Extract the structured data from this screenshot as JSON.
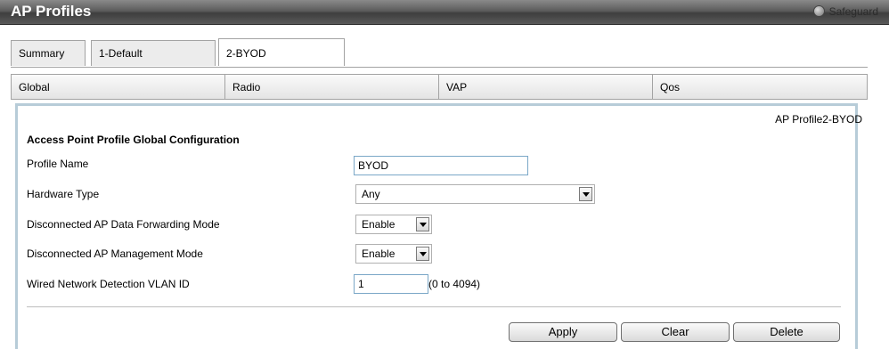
{
  "header": {
    "title": "AP Profiles",
    "safeguard_label": "Safeguard"
  },
  "profile_tabs": [
    {
      "label": "Summary"
    },
    {
      "label": "1-Default"
    },
    {
      "label": "2-BYOD",
      "active": true
    }
  ],
  "section_tabs": [
    {
      "label": "Global",
      "active": true
    },
    {
      "label": "Radio"
    },
    {
      "label": "VAP"
    },
    {
      "label": "Qos"
    }
  ],
  "panel": {
    "profile_label": "AP Profile2-BYOD",
    "heading": "Access Point Profile Global Configuration",
    "profile_name": {
      "label": "Profile Name",
      "value": "BYOD"
    },
    "hardware_type": {
      "label": "Hardware Type",
      "value": "Any"
    },
    "data_forwarding_mode": {
      "label": "Disconnected AP Data Forwarding Mode",
      "value": "Enable"
    },
    "management_mode": {
      "label": "Disconnected AP Management Mode",
      "value": "Enable"
    },
    "vlan_id": {
      "label": "Wired Network Detection VLAN ID",
      "value": "1",
      "hint": "(0 to 4094)"
    }
  },
  "buttons": {
    "apply": "Apply",
    "clear": "Clear",
    "delete": "Delete"
  }
}
